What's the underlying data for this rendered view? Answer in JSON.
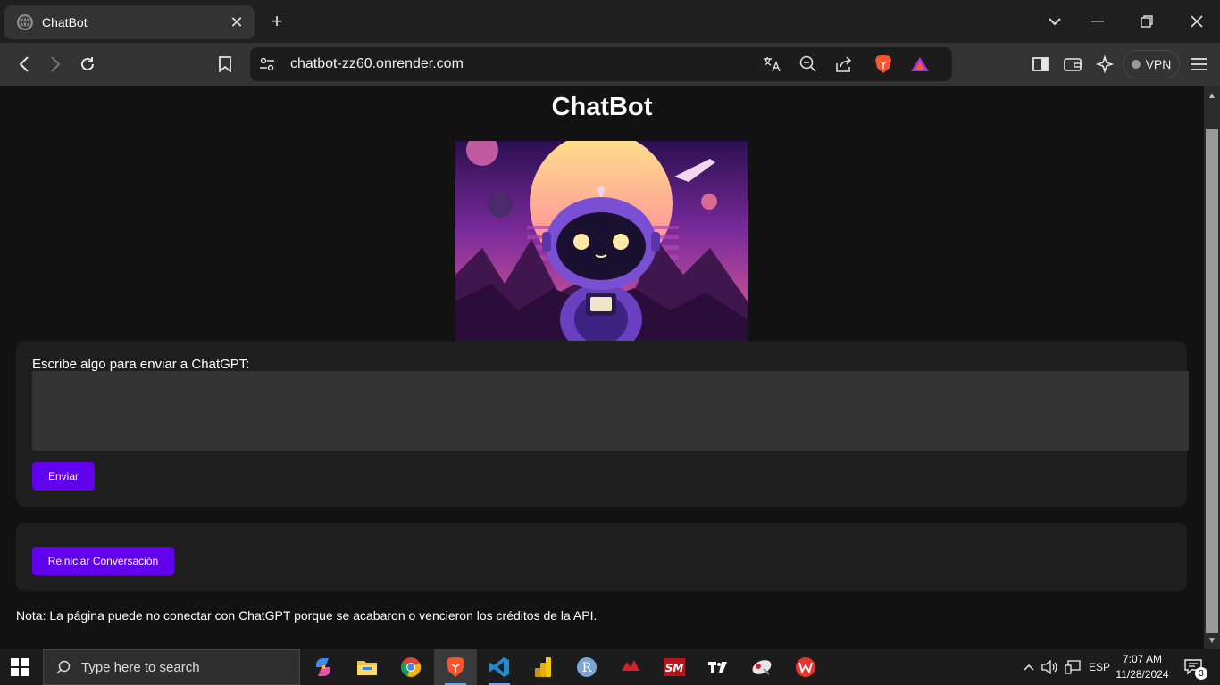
{
  "browser": {
    "tab": {
      "title": "ChatBot"
    },
    "address": {
      "url": "chatbot-zz60.onrender.com"
    },
    "vpn_label": "VPN"
  },
  "page": {
    "title": "ChatBot",
    "prompt_label": "Escribe algo para enviar a ChatGPT:",
    "textarea_value": "",
    "send_label": "Enviar",
    "reset_label": "Reiniciar Conversación",
    "note": "Nota: La página puede no conectar con ChatGPT porque se acabaron o vencieron los créditos de la API."
  },
  "taskbar": {
    "search_placeholder": "Type here to search",
    "apps": [
      "copilot-icon",
      "file-explorer-icon",
      "chrome-icon",
      "brave-icon",
      "vscode-icon",
      "power-bi-icon",
      "r-icon",
      "game-icon",
      "sm-icon",
      "tradingview-icon",
      "app-icon",
      "wps-icon"
    ],
    "language": "ESP",
    "time": "7:07 AM",
    "date": "11/28/2024",
    "notifications": "3"
  },
  "colors": {
    "accent_button": "#6200ee",
    "page_bg": "#121212",
    "card_bg": "#1e1e1e"
  }
}
